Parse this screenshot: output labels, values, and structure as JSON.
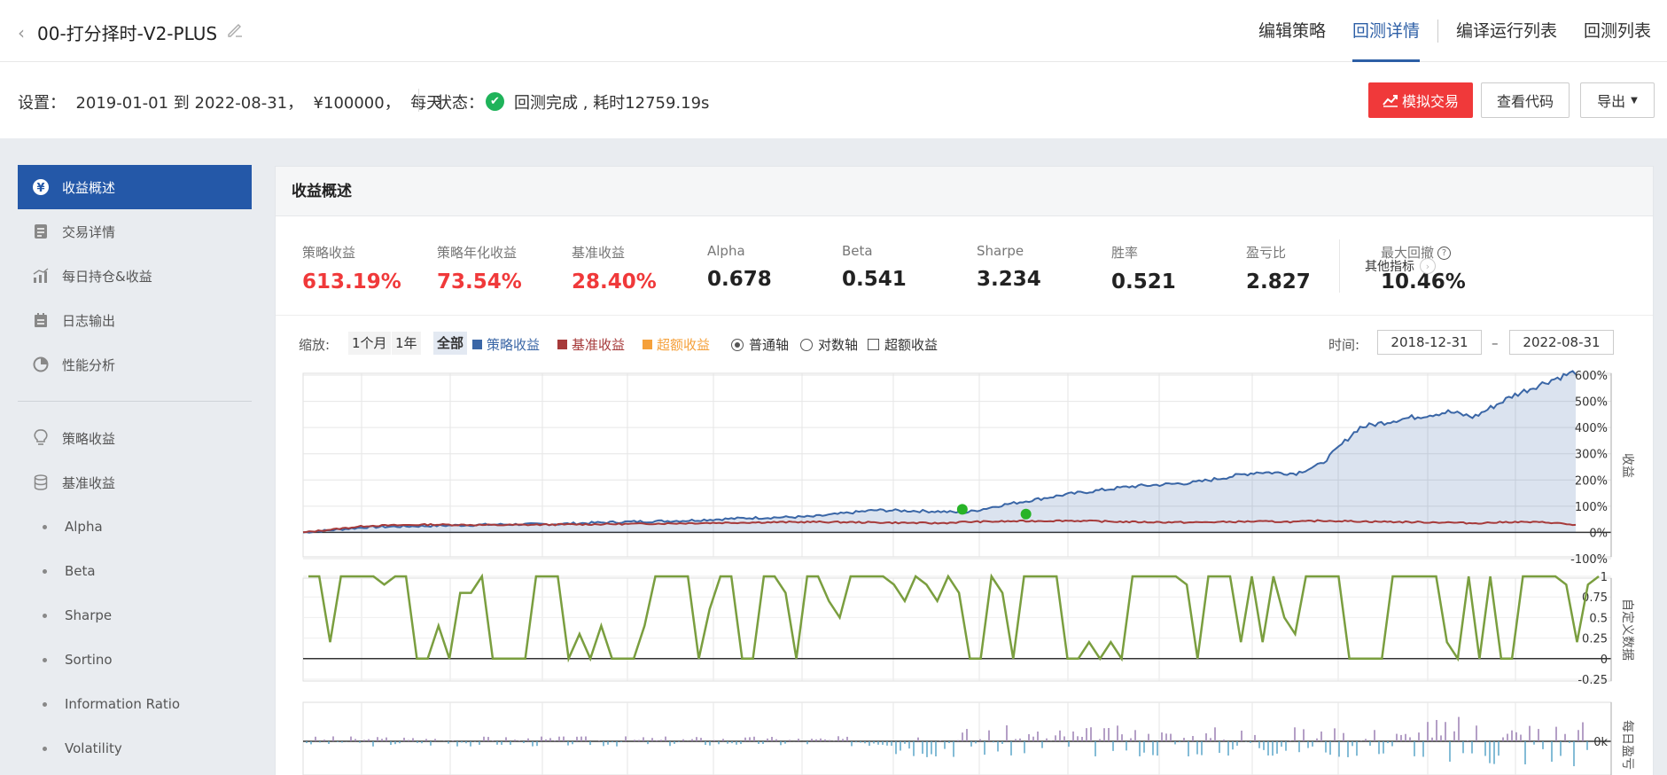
{
  "header": {
    "back_symbol": "‹",
    "title": "00-打分择时-V2-PLUS",
    "nav": [
      {
        "label": "编辑策略",
        "active": false
      },
      {
        "label": "回测详情",
        "active": true
      },
      {
        "label": "编译运行列表",
        "active": false
      },
      {
        "label": "回测列表",
        "active": false
      }
    ]
  },
  "info": {
    "settings": "设置：  2019-01-01 到 2022-08-31，  ¥100000，  每天",
    "status_label": "状态：",
    "status_icon": "check-icon",
    "status_text": "回测完成 , 耗时12759.19s",
    "buttons": {
      "simulate": "模拟交易",
      "view_code": "查看代码",
      "export": "导出"
    }
  },
  "sidebar": {
    "items": [
      {
        "label": "收益概述",
        "icon": "yen-icon",
        "active": true
      },
      {
        "label": "交易详情",
        "icon": "document-icon"
      },
      {
        "label": "每日持仓&收益",
        "icon": "bar-chart-icon"
      },
      {
        "label": "日志输出",
        "icon": "calendar-icon"
      },
      {
        "label": "性能分析",
        "icon": "pie-chart-icon"
      }
    ],
    "items2": [
      {
        "label": "策略收益",
        "icon": "bulb-icon"
      },
      {
        "label": "基准收益",
        "icon": "database-icon"
      }
    ],
    "subitems": [
      "Alpha",
      "Beta",
      "Sharpe",
      "Sortino",
      "Information Ratio",
      "Volatility"
    ]
  },
  "panel": {
    "title": "收益概述",
    "metrics": [
      {
        "label": "策略收益",
        "value": "613.19%",
        "red": true
      },
      {
        "label": "策略年化收益",
        "value": "73.54%",
        "red": true
      },
      {
        "label": "基准收益",
        "value": "28.40%",
        "red": true
      },
      {
        "label": "Alpha",
        "value": "0.678"
      },
      {
        "label": "Beta",
        "value": "0.541"
      },
      {
        "label": "Sharpe",
        "value": "3.234"
      },
      {
        "label": "胜率",
        "value": "0.521"
      },
      {
        "label": "盈亏比",
        "value": "2.827"
      },
      {
        "label": "最大回撤",
        "value": "10.46%",
        "help": true
      }
    ],
    "other_metrics": "其他指标"
  },
  "toolbar": {
    "zoom_label": "缩放:",
    "zoom": [
      "1个月",
      "1年",
      "全部"
    ],
    "legend": [
      {
        "label": "策略收益",
        "color": "#3a66a6"
      },
      {
        "label": "基准收益",
        "color": "#a63a3a"
      },
      {
        "label": "超额收益",
        "color": "#f5a03a"
      }
    ],
    "axis_options": [
      "普通轴",
      "对数轴"
    ],
    "excess_checkbox": "超额收益",
    "time_label": "时间:",
    "date_from": "2018-12-31",
    "date_to": "2022-08-31",
    "date_dash": "–"
  },
  "chart_data": [
    {
      "type": "area",
      "ylabel": "收益",
      "y_ticks": [
        "600%",
        "500%",
        "400%",
        "300%",
        "200%",
        "100%",
        "0%",
        "-100%"
      ],
      "ylim": [
        -100,
        600
      ],
      "x": [
        0,
        0.05,
        0.1,
        0.15,
        0.2,
        0.25,
        0.3,
        0.35,
        0.4,
        0.45,
        0.5,
        0.52,
        0.55,
        0.6,
        0.65,
        0.7,
        0.75,
        0.78,
        0.8,
        0.83,
        0.86,
        0.9,
        0.92,
        0.95,
        0.98,
        1.0
      ],
      "series": [
        {
          "name": "策略收益",
          "color": "#3a66a6",
          "values": [
            0,
            20,
            25,
            30,
            32,
            40,
            45,
            55,
            60,
            85,
            80,
            75,
            105,
            145,
            175,
            190,
            230,
            225,
            260,
            400,
            430,
            460,
            440,
            520,
            580,
            613
          ]
        },
        {
          "name": "基准收益",
          "color": "#a63a3a",
          "values": [
            0,
            25,
            30,
            28,
            30,
            32,
            35,
            38,
            40,
            38,
            35,
            40,
            42,
            45,
            40,
            38,
            42,
            40,
            45,
            42,
            40,
            38,
            35,
            40,
            38,
            28
          ]
        }
      ],
      "markers": [
        {
          "x": 0.518,
          "y": 88
        },
        {
          "x": 0.568,
          "y": 70
        }
      ]
    },
    {
      "type": "line",
      "ylabel": "自定义数据",
      "y_ticks": [
        "1",
        "0.75",
        "0.5",
        "0.25",
        "0",
        "-0.25"
      ],
      "ylim": [
        -0.25,
        1
      ],
      "series": [
        {
          "name": "",
          "color": "#7a9e3f",
          "values": [
            1,
            1,
            0.2,
            1,
            1,
            1,
            1,
            0.9,
            1,
            1,
            0,
            0,
            0.4,
            0,
            0.8,
            0.8,
            1,
            0,
            0,
            0,
            0,
            1,
            1,
            1,
            0,
            0.3,
            0,
            0.4,
            0,
            0,
            0,
            0.4,
            1,
            1,
            1,
            1,
            0,
            0.6,
            1,
            1,
            0,
            0,
            1,
            1,
            0.8,
            0,
            1,
            1,
            0.7,
            0.5,
            1,
            1,
            1,
            1,
            0.9,
            0.7,
            1,
            0.9,
            0.7,
            1,
            0.8,
            0,
            0,
            1,
            0.8,
            0,
            1,
            1,
            1,
            1,
            0,
            0,
            0.2,
            0,
            0.2,
            0,
            1,
            1,
            1,
            1,
            1,
            0.9,
            0,
            1,
            1,
            1,
            0.2,
            1,
            0.2,
            1,
            0.5,
            0.3,
            1,
            1,
            1,
            1,
            0,
            0,
            0,
            0,
            1,
            1,
            1,
            1,
            1,
            0.2,
            0,
            1,
            0,
            1,
            0,
            0,
            1,
            1,
            1,
            1,
            0.9,
            0.2,
            0.9,
            1
          ]
        }
      ]
    },
    {
      "type": "bar",
      "ylabel": "每日盈亏",
      "y_ticks": [
        "0k"
      ]
    }
  ]
}
